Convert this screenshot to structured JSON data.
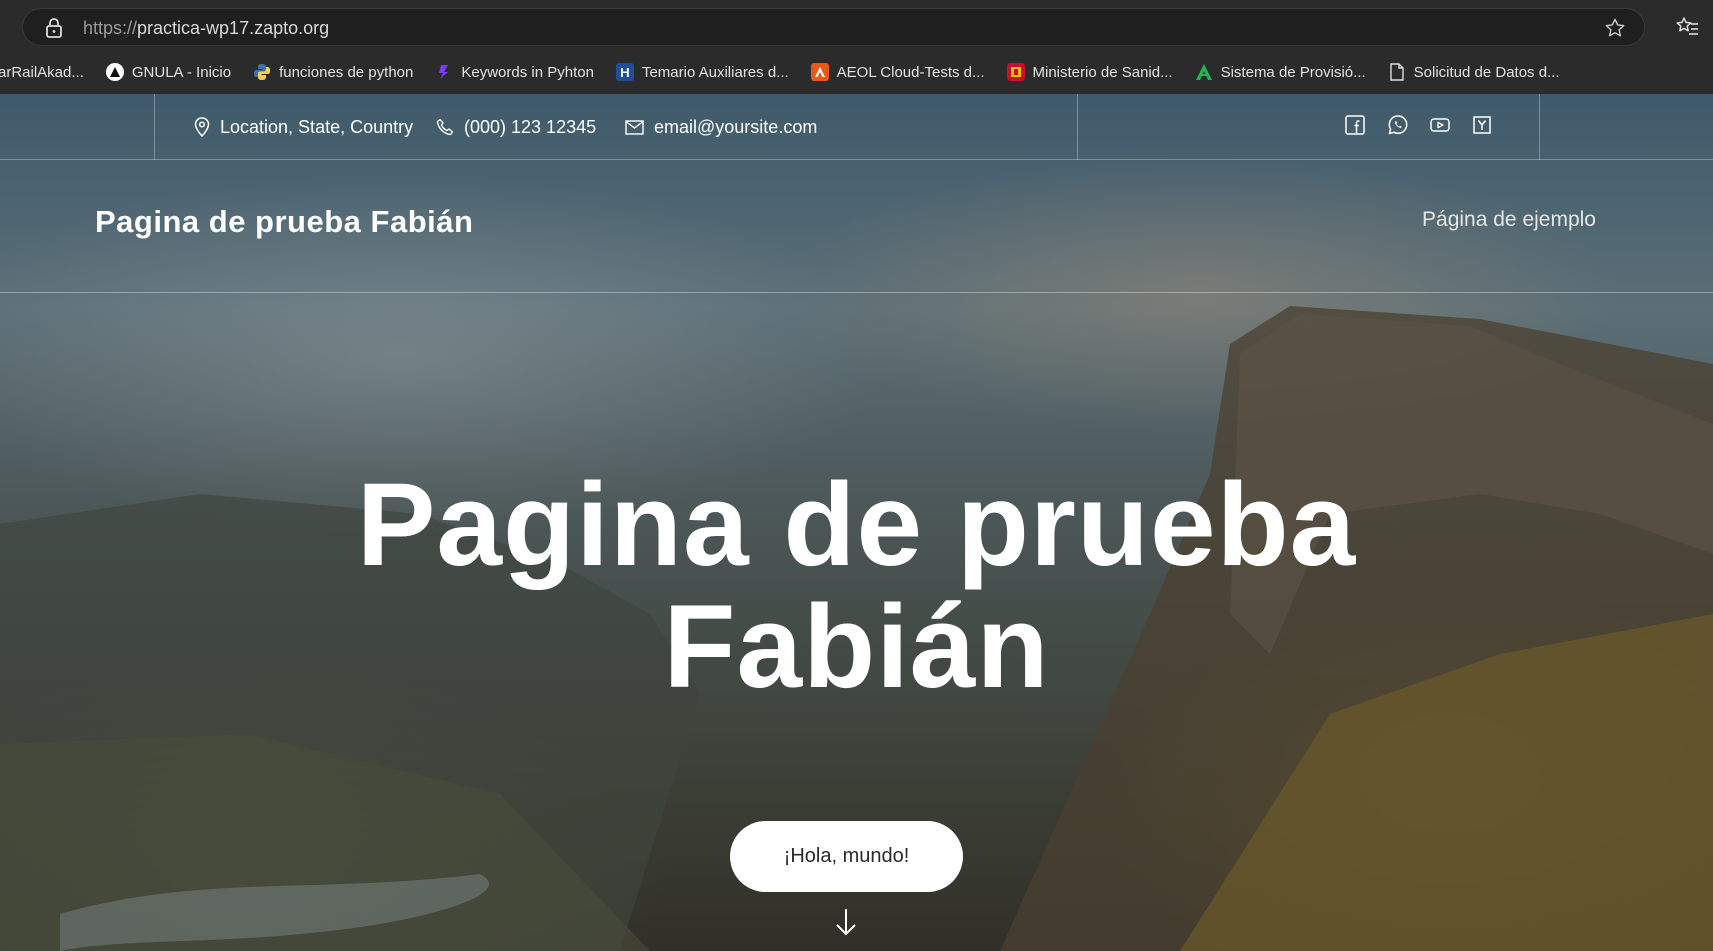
{
  "browser": {
    "url_protocol": "https://",
    "url_host": "practica-wp17.zapto.org",
    "bookmarks": [
      {
        "label": "arRailAkad...",
        "icon": "none"
      },
      {
        "label": "GNULA - Inicio",
        "icon": "gnula-icon"
      },
      {
        "label": "funciones de python",
        "icon": "python-icon"
      },
      {
        "label": "Keywords in Pyhton",
        "icon": "keywords-icon"
      },
      {
        "label": "Temario Auxiliares d...",
        "icon": "h-icon"
      },
      {
        "label": "AEOL Cloud-Tests d...",
        "icon": "aeol-icon"
      },
      {
        "label": "Ministerio de Sanid...",
        "icon": "ministerio-icon"
      },
      {
        "label": "Sistema de Provisió...",
        "icon": "a-icon"
      },
      {
        "label": "Solicitud de Datos d...",
        "icon": "document-icon"
      }
    ]
  },
  "topbar": {
    "location": "Location, State, Country",
    "phone": "(000) 123 12345",
    "email": "email@yoursite.com"
  },
  "header": {
    "site_title": "Pagina de prueba Fabián",
    "nav_link": "Página de ejemplo"
  },
  "hero": {
    "title_line1": "Pagina de prueba",
    "title_line2": "Fabián",
    "button": "¡Hola, mundo!"
  }
}
